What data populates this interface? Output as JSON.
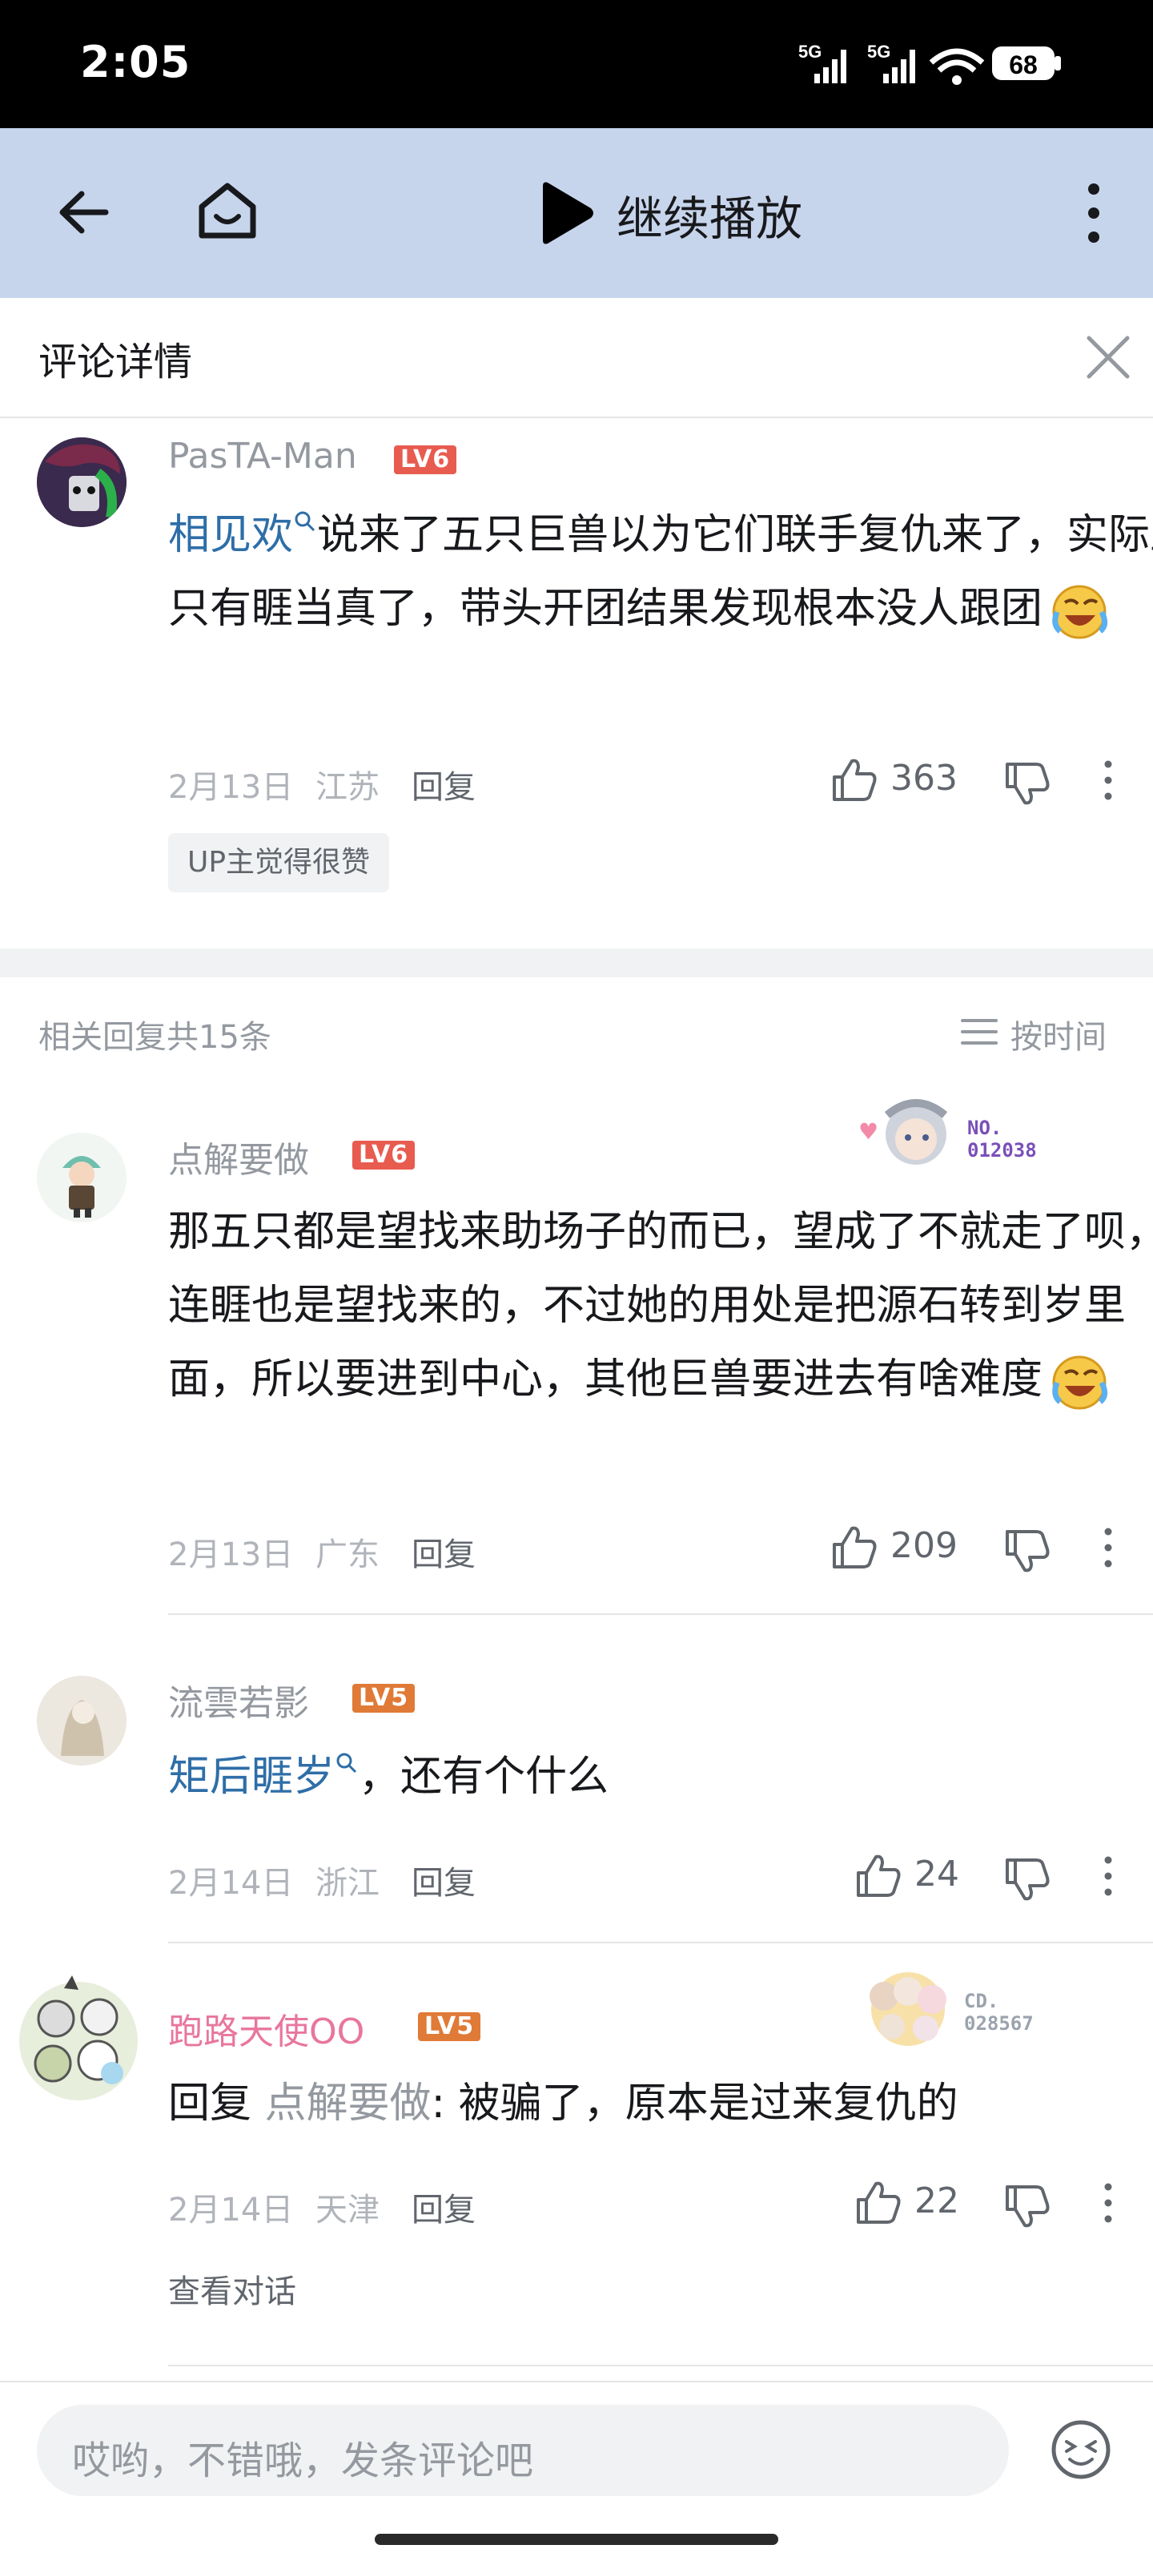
{
  "status_bar": {
    "time": "2:05",
    "net1": "5G",
    "net2": "5G",
    "battery": "68"
  },
  "top_bar": {
    "continue_label": "继续播放",
    "back_icon": "back-arrow-icon",
    "home_icon": "home-icon",
    "play_icon": "play-icon",
    "more_icon": "more-vertical-icon"
  },
  "panel": {
    "title": "评论详情",
    "close_icon": "close-icon"
  },
  "root_comment": {
    "username": "PasTA-Man",
    "level": "LV6",
    "mention": "相见欢",
    "text_rest": "说来了五只巨兽以为它们联手复仇来了，实际上只有睚当真了，带头开团结果发现根本没人跟团",
    "emoji": "cry-laugh-emoji",
    "date": "2月13日",
    "location": "江苏",
    "reply_label": "回复",
    "likes": "363",
    "badge": "UP主觉得很赞"
  },
  "replies_header": {
    "count_label": "相关回复共15条",
    "sort_label": "按时间",
    "sort_icon": "list-icon"
  },
  "replies": [
    {
      "username": "点解要做",
      "level": "LV6",
      "fan_badge_no": "NO.\n012038",
      "text": "那五只都是望找来助场子的而已，望成了不就走了呗，连睚也是望找来的，不过她的用处是把源石转到岁里面，所以要进到中心，其他巨兽要进去有啥难度",
      "date": "2月13日",
      "location": "广东",
      "reply_label": "回复",
      "likes": "209"
    },
    {
      "username": "流雲若影",
      "level": "LV5",
      "mention": "矩后睚岁",
      "text_rest": "，还有个什么",
      "date": "2月14日",
      "location": "浙江",
      "reply_label": "回复",
      "likes": "24"
    },
    {
      "username": "跑路天使OO",
      "level": "LV5",
      "fan_badge_no": "CD.\n028567",
      "reply_prefix": "回复 ",
      "reply_to": "点解要做",
      "text_rest": ": 被骗了，原本是过来复仇的",
      "date": "2月14日",
      "location": "天津",
      "reply_label": "回复",
      "likes": "22",
      "view_conversation": "查看对话"
    }
  ],
  "bottom_bar": {
    "placeholder": "哎哟，不错哦，发条评论吧",
    "emoji_icon": "emoji-face-icon"
  },
  "colors": {
    "top_bar_bg": "#c7d5ec",
    "level6": "#e85b4f",
    "level5": "#e07a37",
    "mention": "#2e6ea8",
    "pink_name": "#e8769e"
  }
}
